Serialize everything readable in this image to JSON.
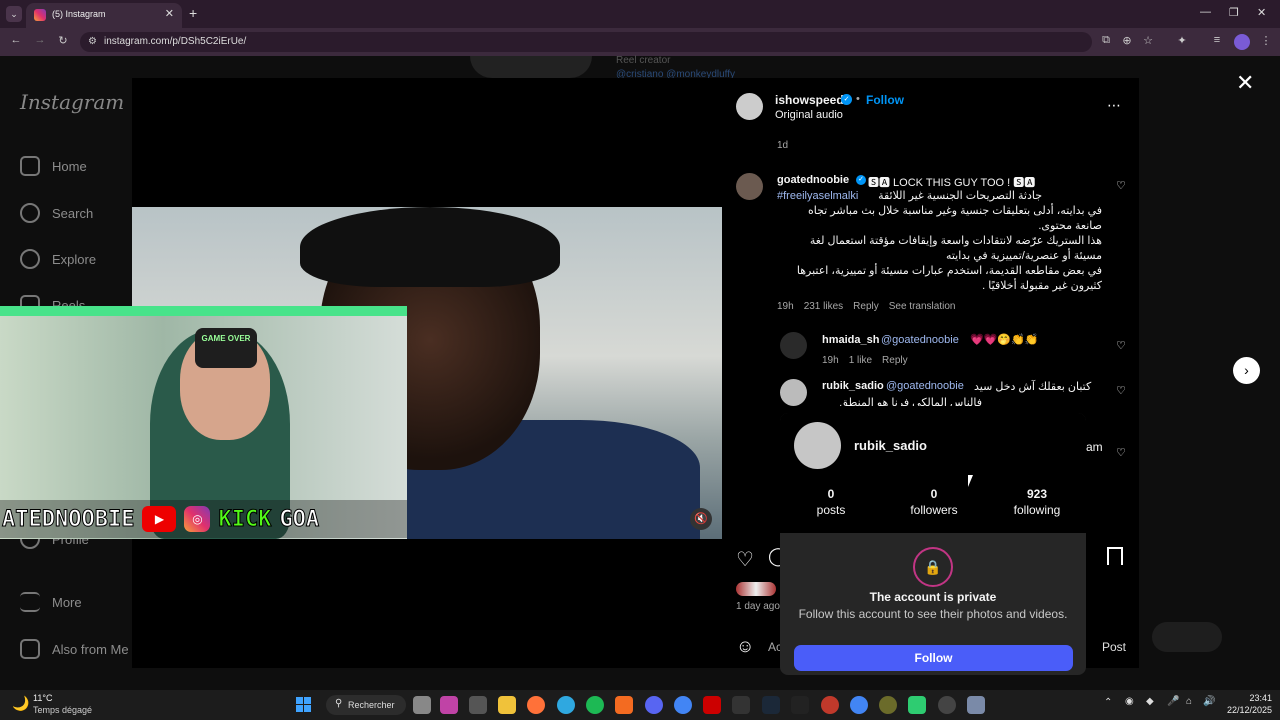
{
  "browser": {
    "tab_title": "(5) Instagram",
    "url": "instagram.com/p/DSh5C2iErUe/"
  },
  "sidebar": {
    "logo": "Instagram",
    "items": [
      {
        "label": "Home",
        "icon": "home-icon"
      },
      {
        "label": "Search",
        "icon": "search-icon"
      },
      {
        "label": "Explore",
        "icon": "compass-icon"
      },
      {
        "label": "Reels",
        "icon": "reels-icon"
      },
      {
        "label": "Profile",
        "icon": "profile-icon"
      },
      {
        "label": "More",
        "icon": "menu-icon"
      },
      {
        "label": "Also from Me",
        "icon": "grid-icon"
      }
    ]
  },
  "bg_profile": {
    "line1": "Reel creator",
    "line2": "@cristiano @monkeydluffy"
  },
  "stream_overlay": {
    "hat_text": "GAME OVER",
    "banner_left": "ATEDNOOBIE",
    "banner_kick": "KICK",
    "banner_right": "GOA"
  },
  "post": {
    "username": "ishowspeed",
    "follow_label": "Follow",
    "audio": "Original audio",
    "time": "1d",
    "likes_text": "1 day ago",
    "comment_placeholder": "Ac",
    "post_label": "Post"
  },
  "comments": [
    {
      "username": "goatednoobie",
      "headline": "🆂🅰 LOCK THIS GUY TOO ! 🆂🅰",
      "hashtag": "#freeilyaselmalki",
      "lines": [
        "جادثة التصريحات الجنسية غير اللائقة",
        "في بدايته، أدلى بتعليقات جنسية وغير مناسبة خلال بث مباشر تجاه",
        "صانعة محتوى.",
        "هذا الستريك عرّضه لانتقادات واسعة وإيقافات مؤقتة استعمال لغة",
        "مسيئة أو عنصرية/تمييزية في بدايته",
        "في بعض مقاطعه القديمة، استخدم عبارات مسيئة أو تمييزية، اعتبرها",
        "كثيرون غير مقبولة أخلاقيًا ."
      ],
      "time": "19h",
      "likes": "231 likes",
      "reply": "Reply",
      "translate": "See translation"
    },
    {
      "username": "hmaida_sh",
      "mention": "@goatednoobie",
      "emoji": "💗💗🤭👏👏",
      "time": "19h",
      "likes": "1 like",
      "reply": "Reply"
    },
    {
      "username": "rubik_sadio",
      "mention": "@goatednoobie",
      "text": "كتبان بعقلك آش دخل سيد",
      "text2": "فالناس المالكي فرنا هو المنطق"
    }
  ],
  "popover": {
    "username": "rubik_sadio",
    "trailing": "am",
    "posts_n": "0",
    "posts_l": "posts",
    "followers_n": "0",
    "followers_l": "followers",
    "following_n": "923",
    "following_l": "following",
    "private_title": "The account is private",
    "private_sub": "Follow this account to see their photos and videos.",
    "follow_button": "Follow"
  },
  "taskbar": {
    "weather_temp": "11°C",
    "weather_desc": "Temps dégagé",
    "search": "Rechercher",
    "time": "23:41",
    "date": "22/12/2025"
  }
}
